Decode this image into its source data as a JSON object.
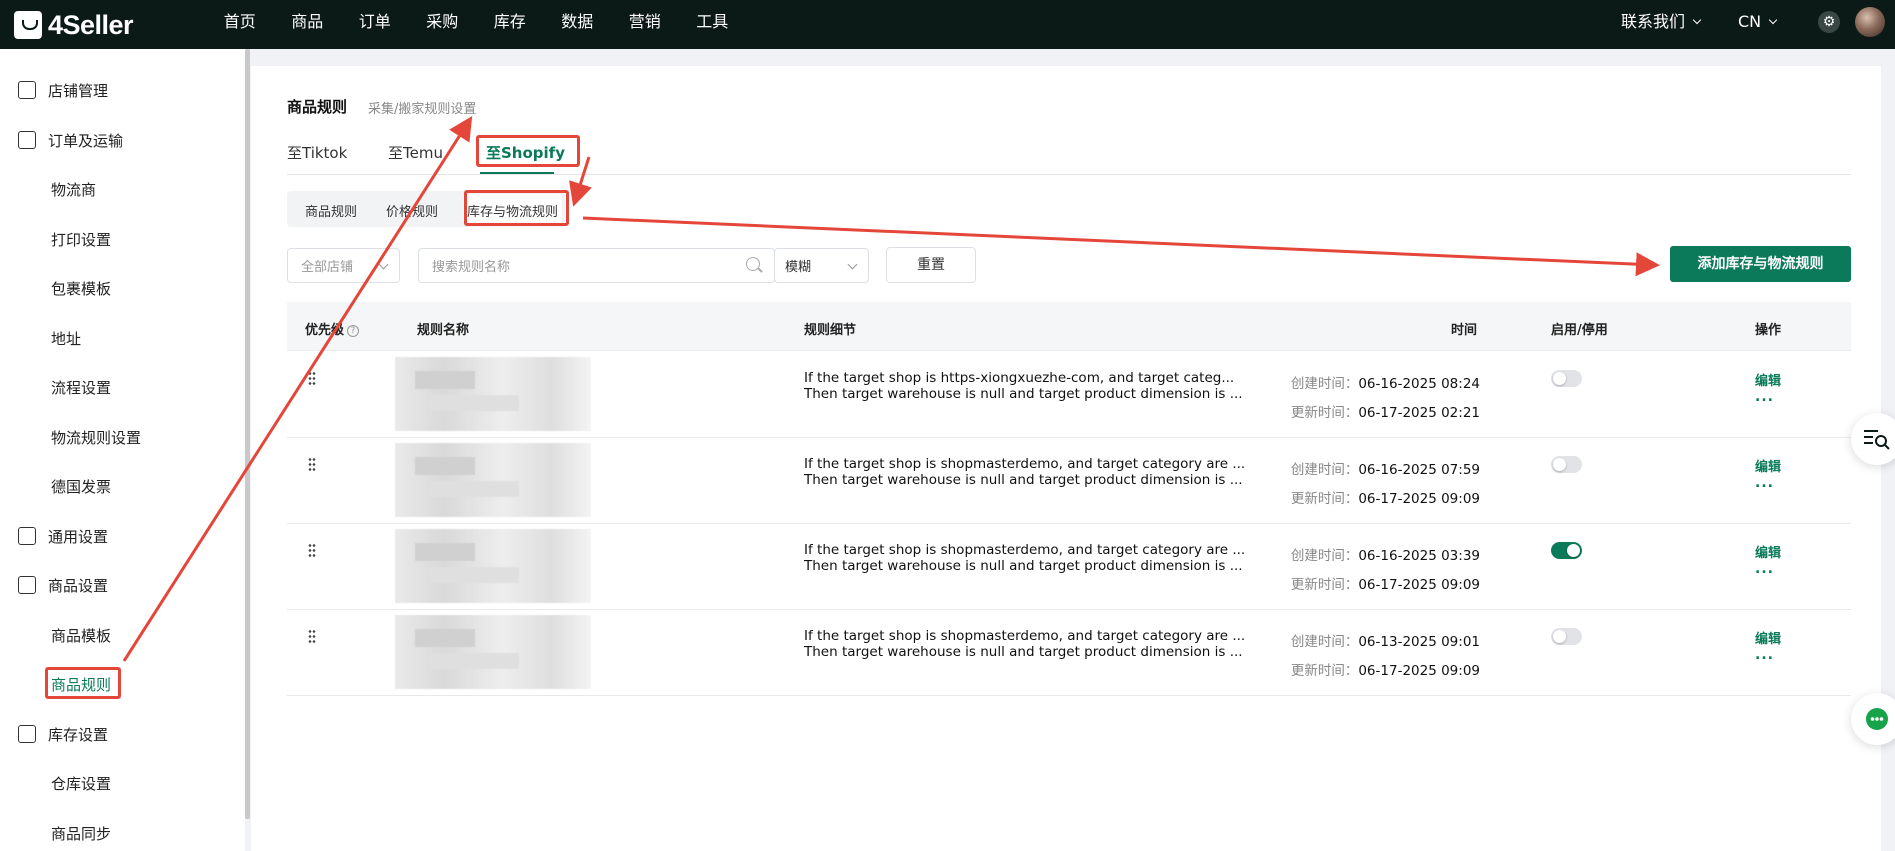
{
  "app": {
    "logo_text": "4Seller"
  },
  "topnav": {
    "items": [
      "首页",
      "商品",
      "订单",
      "采购",
      "库存",
      "数据",
      "营销",
      "工具"
    ]
  },
  "topright": {
    "contact": "联系我们",
    "lang": "CN"
  },
  "sidebar": {
    "items": [
      {
        "label": "店铺管理",
        "type": "group",
        "icon": "store-icon"
      },
      {
        "label": "订单及运输",
        "type": "group",
        "icon": "order-icon"
      },
      {
        "label": "物流商",
        "type": "sub"
      },
      {
        "label": "打印设置",
        "type": "sub"
      },
      {
        "label": "包裹模板",
        "type": "sub"
      },
      {
        "label": "地址",
        "type": "sub"
      },
      {
        "label": "流程设置",
        "type": "sub"
      },
      {
        "label": "物流规则设置",
        "type": "sub"
      },
      {
        "label": "德国发票",
        "type": "sub"
      },
      {
        "label": "通用设置",
        "type": "group",
        "icon": "printer-icon"
      },
      {
        "label": "商品设置",
        "type": "group",
        "icon": "upload-icon"
      },
      {
        "label": "商品模板",
        "type": "sub"
      },
      {
        "label": "商品规则",
        "type": "sub",
        "active": true
      },
      {
        "label": "库存设置",
        "type": "group",
        "icon": "inventory-icon"
      },
      {
        "label": "仓库设置",
        "type": "sub"
      },
      {
        "label": "商品同步",
        "type": "sub"
      }
    ]
  },
  "page": {
    "title": "商品规则",
    "subtitle": "采集/搬家规则设置"
  },
  "tabs": [
    "至Tiktok",
    "至Temu",
    "至Shopify"
  ],
  "subtabs": [
    "商品规则",
    "价格规则",
    "库存与物流规则"
  ],
  "filters": {
    "store_placeholder": "全部店铺",
    "search_placeholder": "搜索规则名称",
    "match_mode": "模糊",
    "reset_label": "重置",
    "add_label": "添加库存与物流规则"
  },
  "table": {
    "headers": {
      "priority": "优先级",
      "name": "规则名称",
      "detail": "规则细节",
      "time": "时间",
      "toggle": "启用/停用",
      "action": "操作"
    },
    "created_label": "创建时间：",
    "updated_label": "更新时间：",
    "edit_label": "编辑",
    "more_label": "...",
    "rows": [
      {
        "detail_line1": "If the target shop is https-xiongxuezhe-com, and target categ...",
        "detail_line2": "Then target warehouse is null and target product dimension is ...",
        "created": "06-16-2025 08:24",
        "updated": "06-17-2025 02:21",
        "enabled": false
      },
      {
        "detail_line1": "If the target shop is shopmasterdemo, and target category are ...",
        "detail_line2": "Then target warehouse is null and target product dimension is ...",
        "created": "06-16-2025 07:59",
        "updated": "06-17-2025 09:09",
        "enabled": false
      },
      {
        "detail_line1": "If the target shop is shopmasterdemo, and target category are ...",
        "detail_line2": "Then target warehouse is null and target product dimension is ...",
        "created": "06-16-2025 03:39",
        "updated": "06-17-2025 09:09",
        "enabled": true
      },
      {
        "detail_line1": "If the target shop is shopmasterdemo, and target category are ...",
        "detail_line2": "Then target warehouse is null and target product dimension is ...",
        "created": "06-13-2025 09:01",
        "updated": "06-17-2025 09:09",
        "enabled": false
      }
    ]
  },
  "colors": {
    "brand": "#0a7a5a",
    "topbar": "#0c1a17",
    "annotation": "#e5463a"
  }
}
